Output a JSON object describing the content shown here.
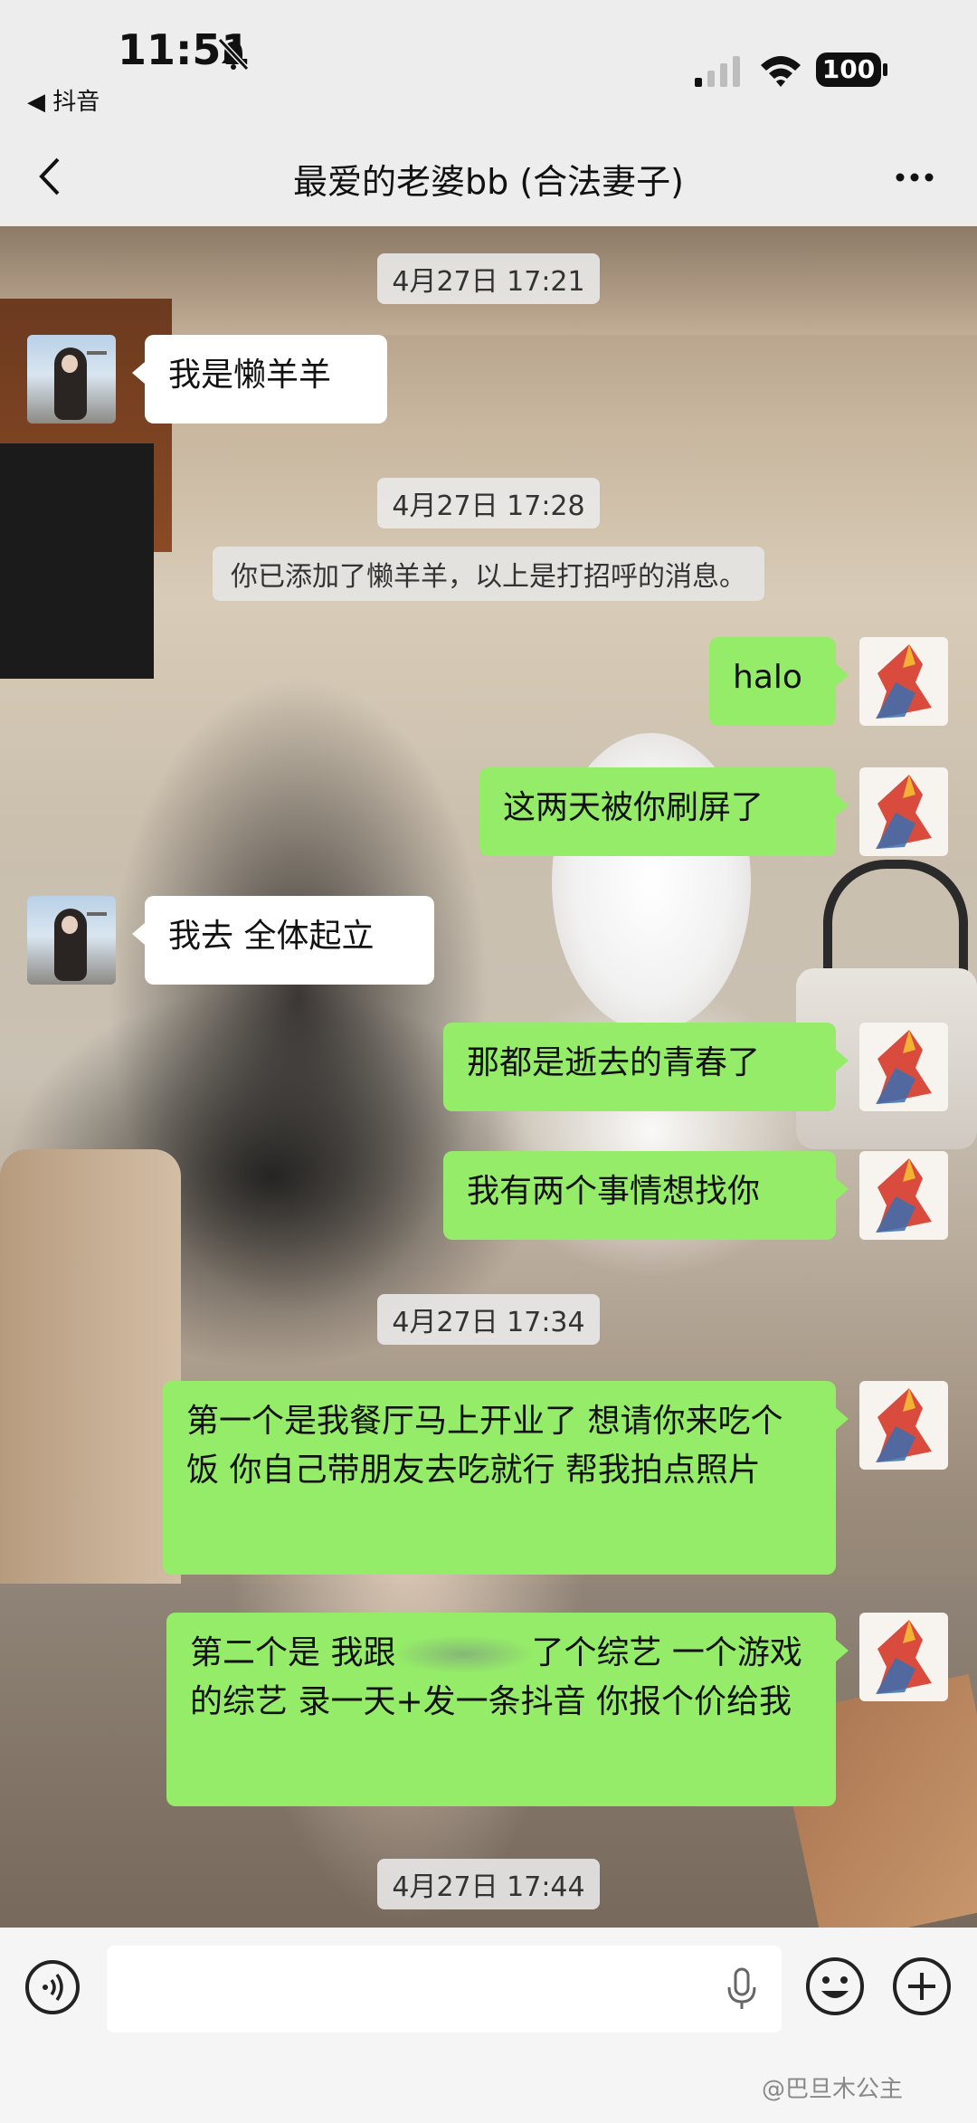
{
  "status_bar": {
    "time": "11:51",
    "back_app": "◀ 抖音",
    "battery": "100"
  },
  "nav": {
    "title": "最爱的老婆bb (合法妻子)"
  },
  "messages": {
    "ts1": "4月27日 17:21",
    "m1": "我是懒羊羊",
    "ts2": "4月27日 17:28",
    "sys": "你已添加了懒羊羊，以上是打招呼的消息。",
    "m2": "halo",
    "m3": "这两天被你刷屏了",
    "m4": "我去 全体起立",
    "m5": "那都是逝去的青春了",
    "m6": "我有两个事情想找你",
    "ts3": "4月27日 17:34",
    "m7": "第一个是我餐厅马上开业了 想请你来吃个饭 你自己带朋友去吃就行 帮我拍点照片",
    "m8_a": "第二个是 我跟",
    "m8_b": "了个综艺 一个游戏的综艺 录一天+发一条抖音 你报个价给我",
    "ts4": "4月27日 17:44"
  },
  "watermark": "@巴旦木公主",
  "colors": {
    "outgoing_bubble": "#95ec69",
    "incoming_bubble": "#ffffff",
    "bar_bg": "#ededed"
  },
  "icons": [
    "bell-muted-icon",
    "signal-icon",
    "wifi-icon",
    "battery-icon",
    "back-chevron-icon",
    "more-icon",
    "voice-icon",
    "mic-icon",
    "emoji-icon",
    "plus-icon"
  ]
}
